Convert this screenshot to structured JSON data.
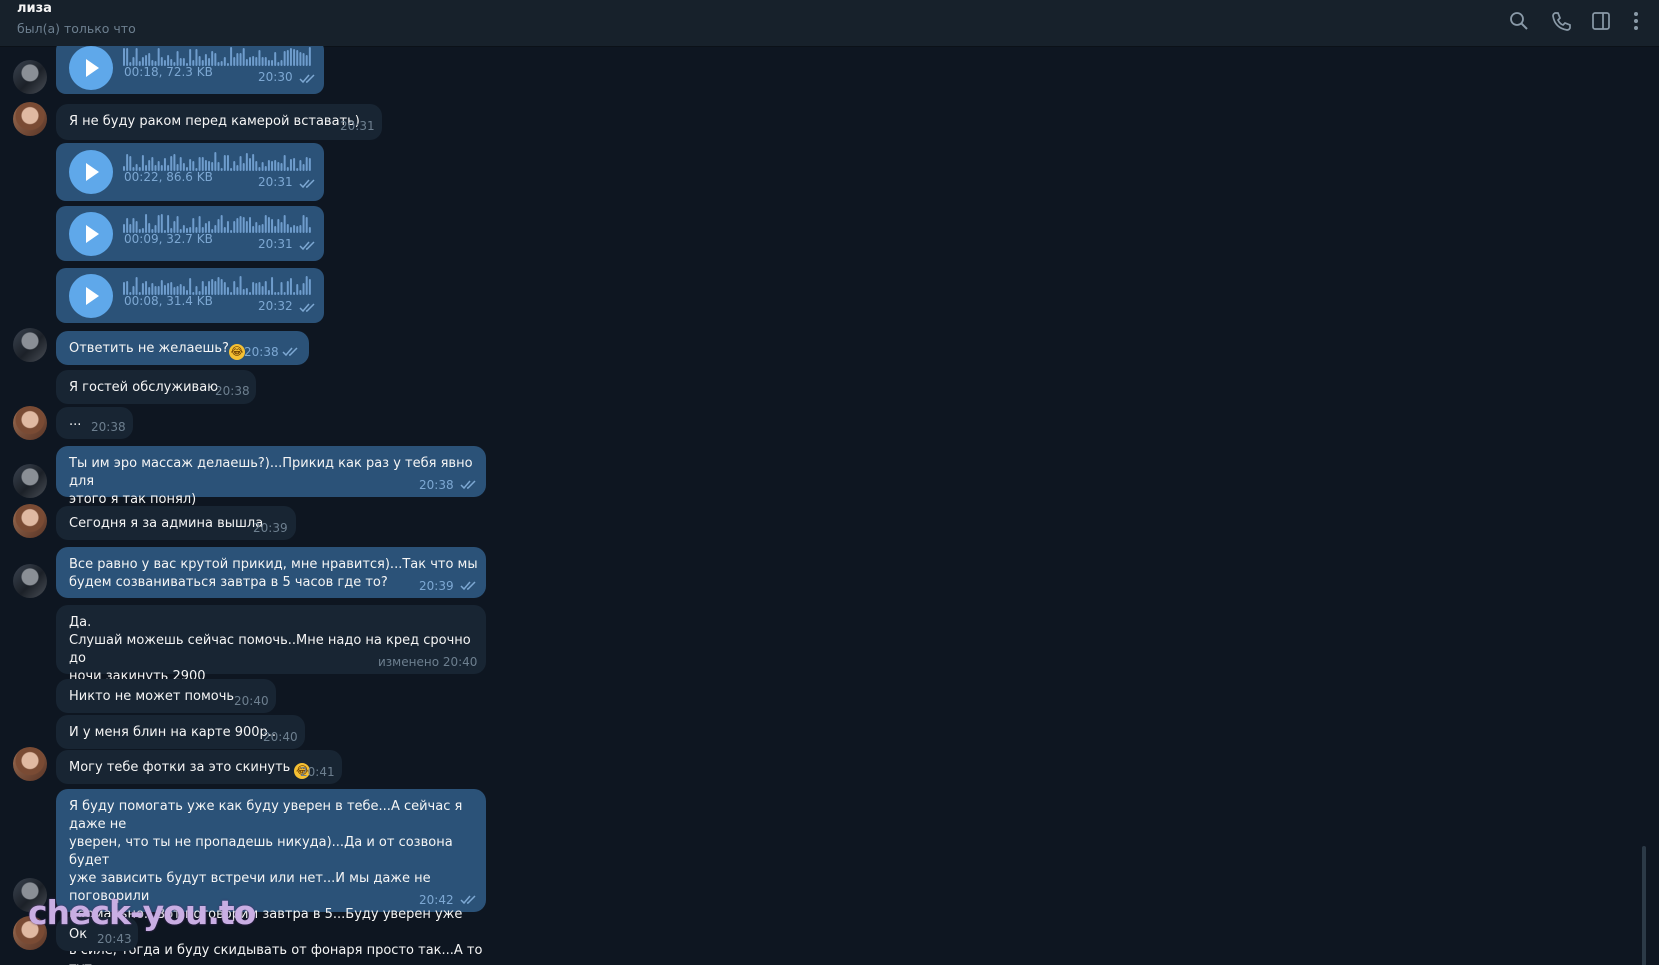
{
  "header": {
    "chat_name": "лиза",
    "status": "был(а) только что",
    "icons": [
      "search-icon",
      "phone-icon",
      "sidebar-toggle-icon",
      "more-vertical-icon"
    ]
  },
  "messages": [
    {
      "type": "voice",
      "duration_size": "00:18, 72.3 KB",
      "time": "20:30"
    },
    {
      "type": "text",
      "text": "Я не буду раком перед камерой вставать)",
      "time": "20:31"
    },
    {
      "type": "voice",
      "duration_size": "00:22, 86.6 KB",
      "time": "20:31"
    },
    {
      "type": "voice",
      "duration_size": "00:09, 32.7 KB",
      "time": "20:31"
    },
    {
      "type": "voice",
      "duration_size": "00:08, 31.4 KB",
      "time": "20:32"
    },
    {
      "type": "text",
      "text": "Ответить не желаешь?",
      "emoji": "😂",
      "time": "20:38"
    },
    {
      "type": "text",
      "text": "Я гостей обслуживаю",
      "time": "20:38"
    },
    {
      "type": "text",
      "text": "...",
      "time": "20:38"
    },
    {
      "type": "text",
      "text": "Ты им эро массаж делаешь?)...Прикид как раз у тебя явно для\nэтого я так понял)",
      "time": "20:38"
    },
    {
      "type": "text",
      "text": "Сегодня я за админа вышла",
      "time": "20:39"
    },
    {
      "type": "text",
      "text": "Все равно у вас крутой прикид, мне нравится)...Так что мы\nбудем созваниваться завтра в 5 часов где то?",
      "time": "20:39"
    },
    {
      "type": "text",
      "text": "Да.\nСлушай можешь сейчас помочь..Мне надо на кред срочно до\nночи закинуть 2900",
      "time": "изменено 20:40"
    },
    {
      "type": "text",
      "text": "Никто не может помочь",
      "time": "20:40"
    },
    {
      "type": "text",
      "text": "И у меня блин на карте 900р..",
      "time": "20:40"
    },
    {
      "type": "text",
      "text": "Могу тебе фотки за это скинуть ",
      "emoji": "😂",
      "time": "20:41"
    },
    {
      "type": "text",
      "text": "Я буду помогать уже как буду уверен в тебе...А сейчас я даже не\nуверен, что ты не пропадешь никуда)...Да и от созвона будет\nуже  зависить будут встречи или нет...И мы даже не поговорили\nнормально...Вот поговорим завтра в 5...Буду уверен уже что все\nв силе, тогда и буду скидывать от фонаря просто так...А то тут\nвсе чего то просят знаешь ли...Без обид",
      "emoji": "🤷",
      "time": "20:42"
    },
    {
      "type": "text",
      "text": "Ок",
      "time": "20:43"
    }
  ],
  "watermark": "check-you.to",
  "colors": {
    "background": "#0e1621",
    "header": "#17212b",
    "incoming_bubble": "#182533",
    "outgoing_bubble": "#2b5278",
    "accent": "#5fa8ea"
  }
}
